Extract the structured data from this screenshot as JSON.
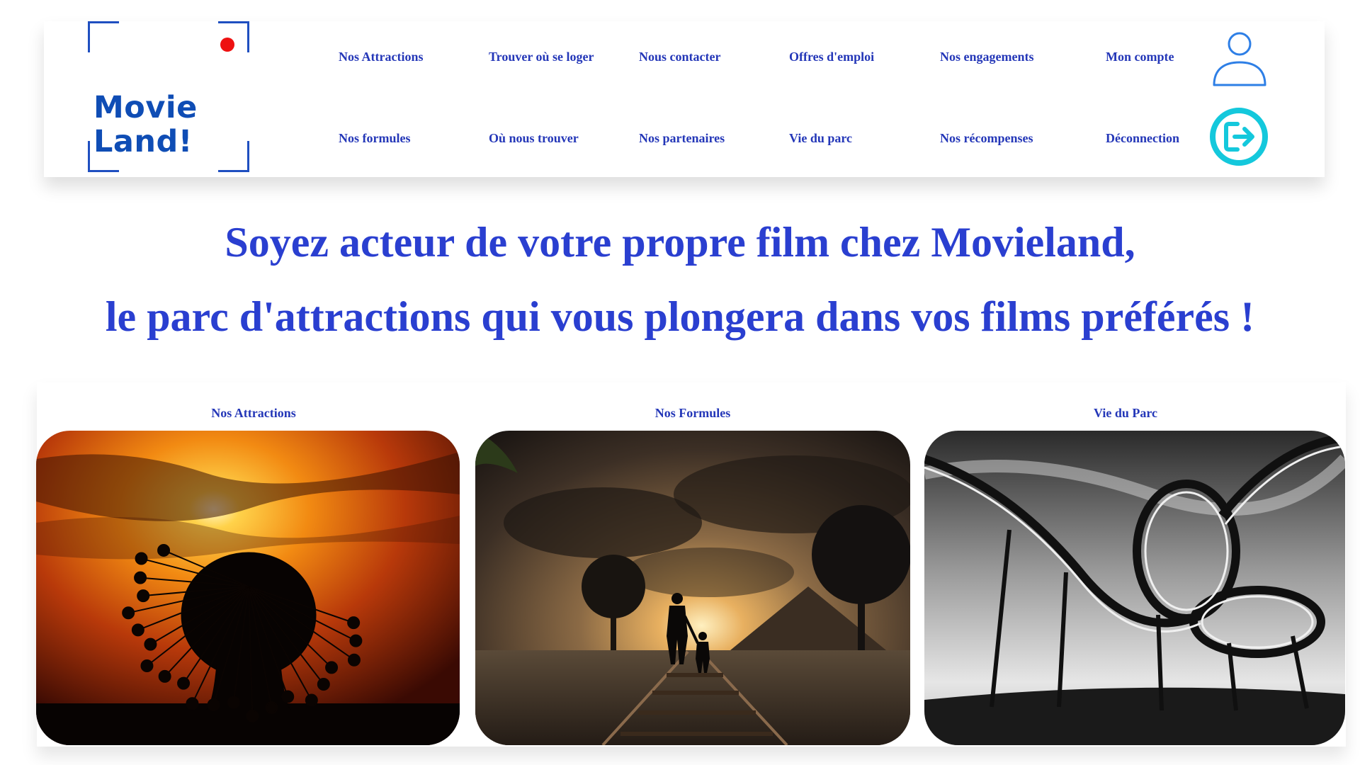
{
  "logo": {
    "line1": "Movie",
    "line2": "Land!"
  },
  "nav": {
    "row1": [
      "Nos Attractions",
      "Trouver où se loger",
      "Nous contacter",
      "Offres d'emploi",
      "Nos engagements",
      "Mon compte"
    ],
    "row2": [
      "Nos formules",
      "Où nous trouver",
      "Nos partenaires",
      "Vie du parc",
      "Nos récompenses",
      "Déconnection"
    ]
  },
  "icons": {
    "account": "user-icon",
    "logout": "logout-icon"
  },
  "hero": {
    "line1": "Soyez acteur de votre propre film chez Movieland,",
    "line2": "le parc d'attractions qui vous plongera dans vos films préférés !"
  },
  "cards": [
    {
      "title": "Nos Attractions",
      "image": "swing-ride-silhouette-sunset"
    },
    {
      "title": "Nos Formules",
      "image": "father-child-railway-sunset"
    },
    {
      "title": "Vie du Parc",
      "image": "roller-coaster-loops-black-white"
    }
  ],
  "colors": {
    "brand_blue": "#0f4db5",
    "link_blue": "#2437b8",
    "hero_blue": "#2a3fd0",
    "record_red": "#ee1111",
    "account_icon": "#2e7fe6",
    "logout_icon": "#14c8dc"
  }
}
